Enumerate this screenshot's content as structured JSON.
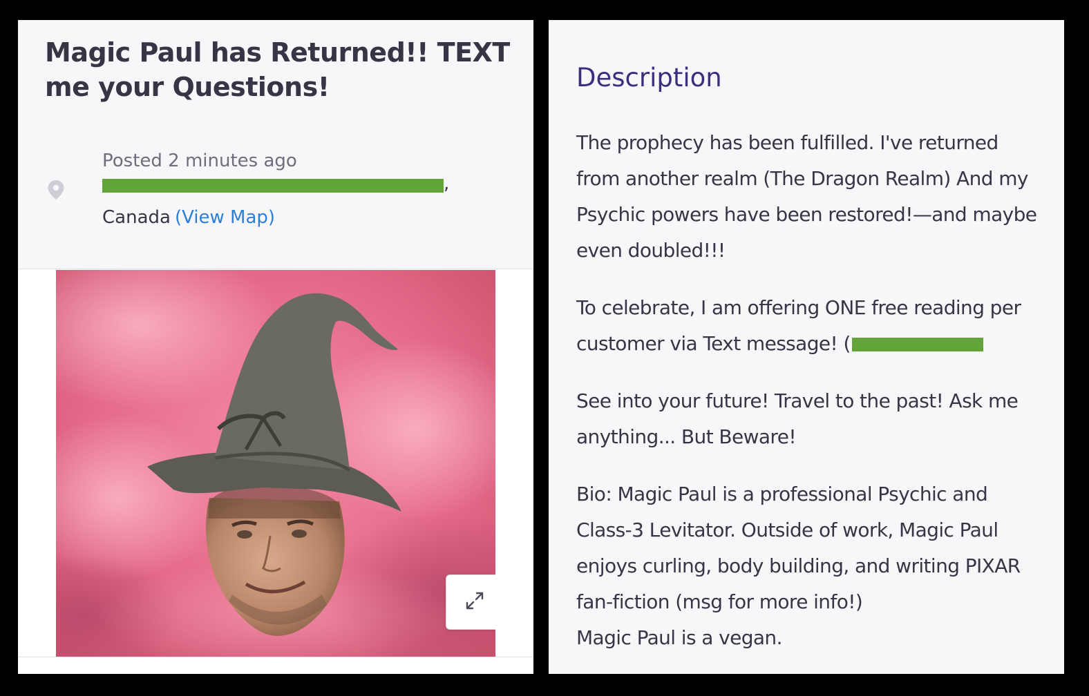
{
  "listing": {
    "title": "Magic Paul has Returned!! TEXT me your Questions!",
    "posted": "Posted 2 minutes ago",
    "address_end": ",",
    "country": "Canada",
    "view_map": "(View Map)"
  },
  "photo": {
    "expand_icon": "expand-arrows-icon"
  },
  "description": {
    "heading": "Description",
    "p1": "The prophecy has been fulfilled. I've returned from another realm (The Dragon Realm) And my Psychic powers have been restored!—and maybe even doubled!!!",
    "p2_prefix": "To celebrate, I am offering ONE free reading per customer via Text message! (",
    "p3": "See into your future! Travel to the past! Ask me anything... But Beware!",
    "p4": "Bio: Magic Paul is a professional Psychic and Class-3 Levitator. Outside of work, Magic Paul enjoys curling, body building, and writing PIXAR fan-fiction (msg for more info!)",
    "p5": "Magic Paul is a vegan."
  },
  "colors": {
    "background": "#000000",
    "card": "#f7f7f9",
    "heading_accent": "#3b2f7d",
    "link": "#2d7fd6",
    "redaction": "#62a33a",
    "photo_bg": "#e26f8e"
  }
}
